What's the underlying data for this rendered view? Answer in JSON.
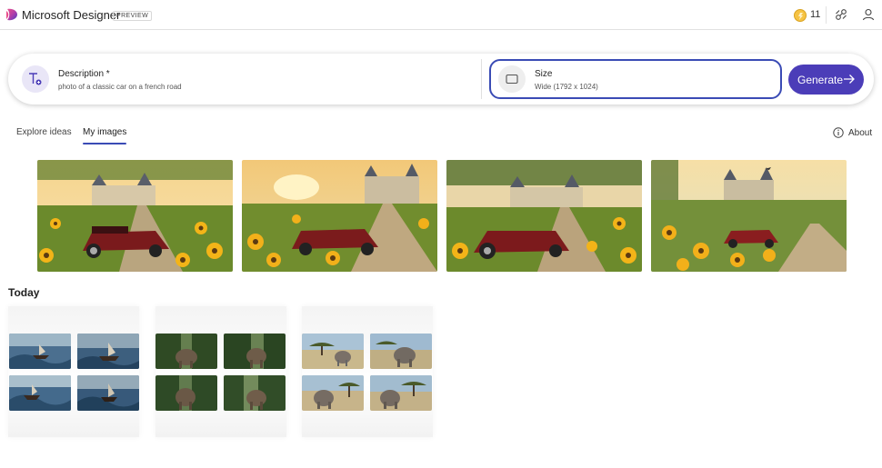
{
  "header": {
    "app_title": "Microsoft Designer",
    "badge": "PREVIEW",
    "coins": "11",
    "icons": [
      "designer-logo-icon",
      "coin-icon",
      "share-icon",
      "profile-icon"
    ]
  },
  "prompt": {
    "description_label": "Description *",
    "description_value": "photo of a classic car on a french road",
    "size_label": "Size",
    "size_value": "Wide (1792 x 1024)",
    "generate_label": "Generate"
  },
  "tabs": [
    {
      "label": "Explore ideas",
      "active": false
    },
    {
      "label": "My images",
      "active": true
    }
  ],
  "about_label": "About",
  "section_title": "Today",
  "colors": {
    "accent": "#4b3db8",
    "focus_border": "#3a4bb5",
    "coin": "#f6c343"
  },
  "images": [
    {
      "subject": "red classic car, castle, sunflowers"
    },
    {
      "subject": "red classic car, castle, sunflowers"
    },
    {
      "subject": "red classic car, castle, sunflowers"
    },
    {
      "subject": "red classic car, castle, sunflowers"
    }
  ],
  "collections": [
    {
      "subject": "ships in stormy sea"
    },
    {
      "subject": "elephant in forest"
    },
    {
      "subject": "elephants on savanna"
    }
  ]
}
